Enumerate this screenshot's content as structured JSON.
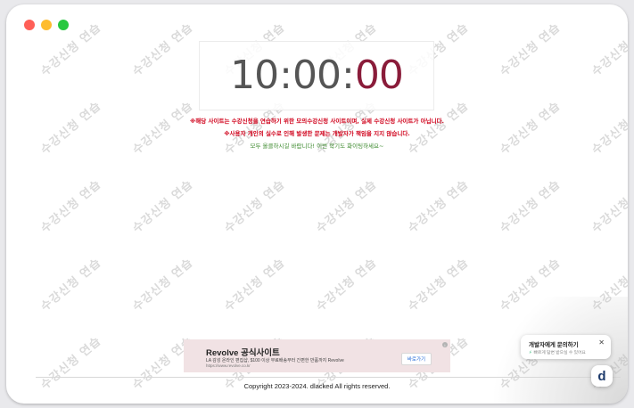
{
  "window": {
    "controls": [
      {
        "name": "close",
        "color": "#ff5f57"
      },
      {
        "name": "minimize",
        "color": "#febc2e"
      },
      {
        "name": "zoom",
        "color": "#28c840"
      }
    ]
  },
  "watermark": {
    "text": "수강신청 연습",
    "color": "#dadada"
  },
  "timer": {
    "hours": "10",
    "minutes": "00",
    "seconds": "00",
    "separator": ":",
    "seconds_color": "#8a1c3a"
  },
  "notices": {
    "line1": "※해당 사이트는 수강신청을 연습하기 위한 모의수강신청 사이트이며, 실제 수강신청 사이트가 아닙니다.",
    "line2": "※사용자 개인의 실수로 인해 발생한 문제는 개발자가 책임을 지지 않습니다.",
    "line3": "모두 올클하시길 바랍니다! 이번 학기도 화이팅하세요~"
  },
  "ad": {
    "title": "Revolve 공식사이트",
    "description": "LA 감성 온라인 편집샵, $100 이상 무료배송부터 간편한 반품까지 Revolve",
    "url": "https://www.revolve.co.kr",
    "button_label": "바로가기",
    "info_icon": "info-icon"
  },
  "footer": {
    "copyright": "Copyright 2023-2024. dlacked All rights reserved."
  },
  "chat": {
    "title": "개발자에게 문의하기",
    "subtitle": "빠르게 답변 받으실 수 있어요",
    "close_icon": "close-icon",
    "launcher_letter": "d"
  }
}
